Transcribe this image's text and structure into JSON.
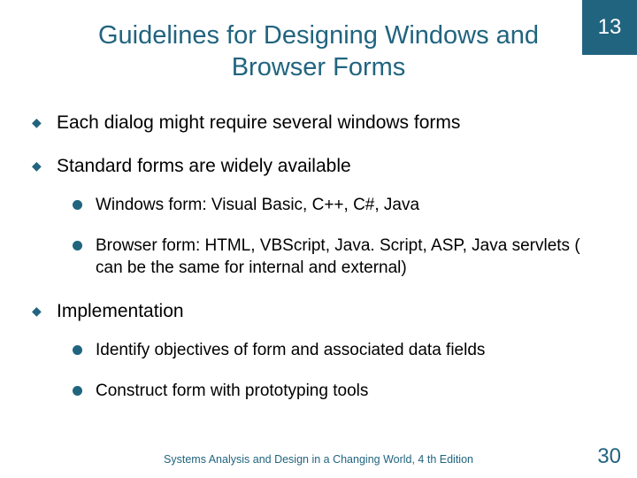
{
  "badge": "13",
  "title": "Guidelines for Designing Windows and Browser Forms",
  "bullets": [
    {
      "text": "Each dialog might require several windows forms",
      "sub": []
    },
    {
      "text": "Standard forms are widely available",
      "sub": [
        "Windows form: Visual Basic, C++, C#, Java",
        "Browser form: HTML, VBScript, Java. Script, ASP, Java servlets ( can be the same for internal and external)"
      ]
    },
    {
      "text": "Implementation",
      "sub": [
        "Identify objectives of form and associated data fields",
        "Construct form with prototyping tools"
      ]
    }
  ],
  "footer": "Systems Analysis and Design in a Changing World, 4 th Edition",
  "page_number": "30",
  "colors": {
    "accent": "#21647f"
  }
}
